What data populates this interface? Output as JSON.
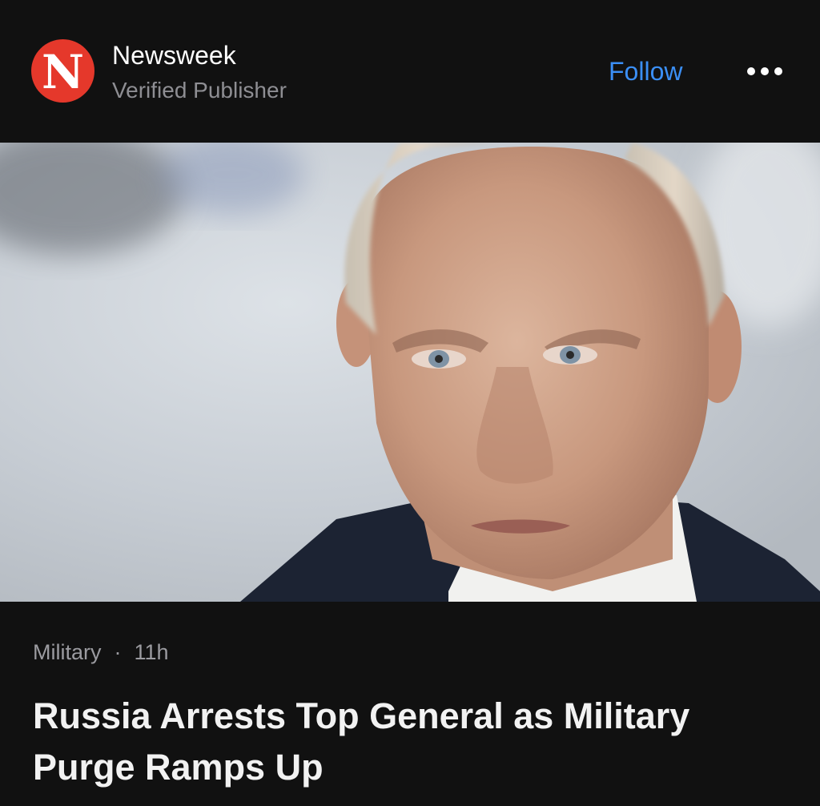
{
  "publisher": {
    "logo_letter": "N",
    "name": "Newsweek",
    "subtitle": "Verified Publisher",
    "brand_color": "#e5382b"
  },
  "actions": {
    "follow_label": "Follow",
    "more_icon": "more-horizontal-icon",
    "accent_color": "#3b8ff6"
  },
  "hero_image": {
    "description_icon": "article-photo"
  },
  "article": {
    "category": "Military",
    "separator": "·",
    "age": "11h",
    "headline": "Russia Arrests Top General as Military Purge Ramps Up"
  }
}
